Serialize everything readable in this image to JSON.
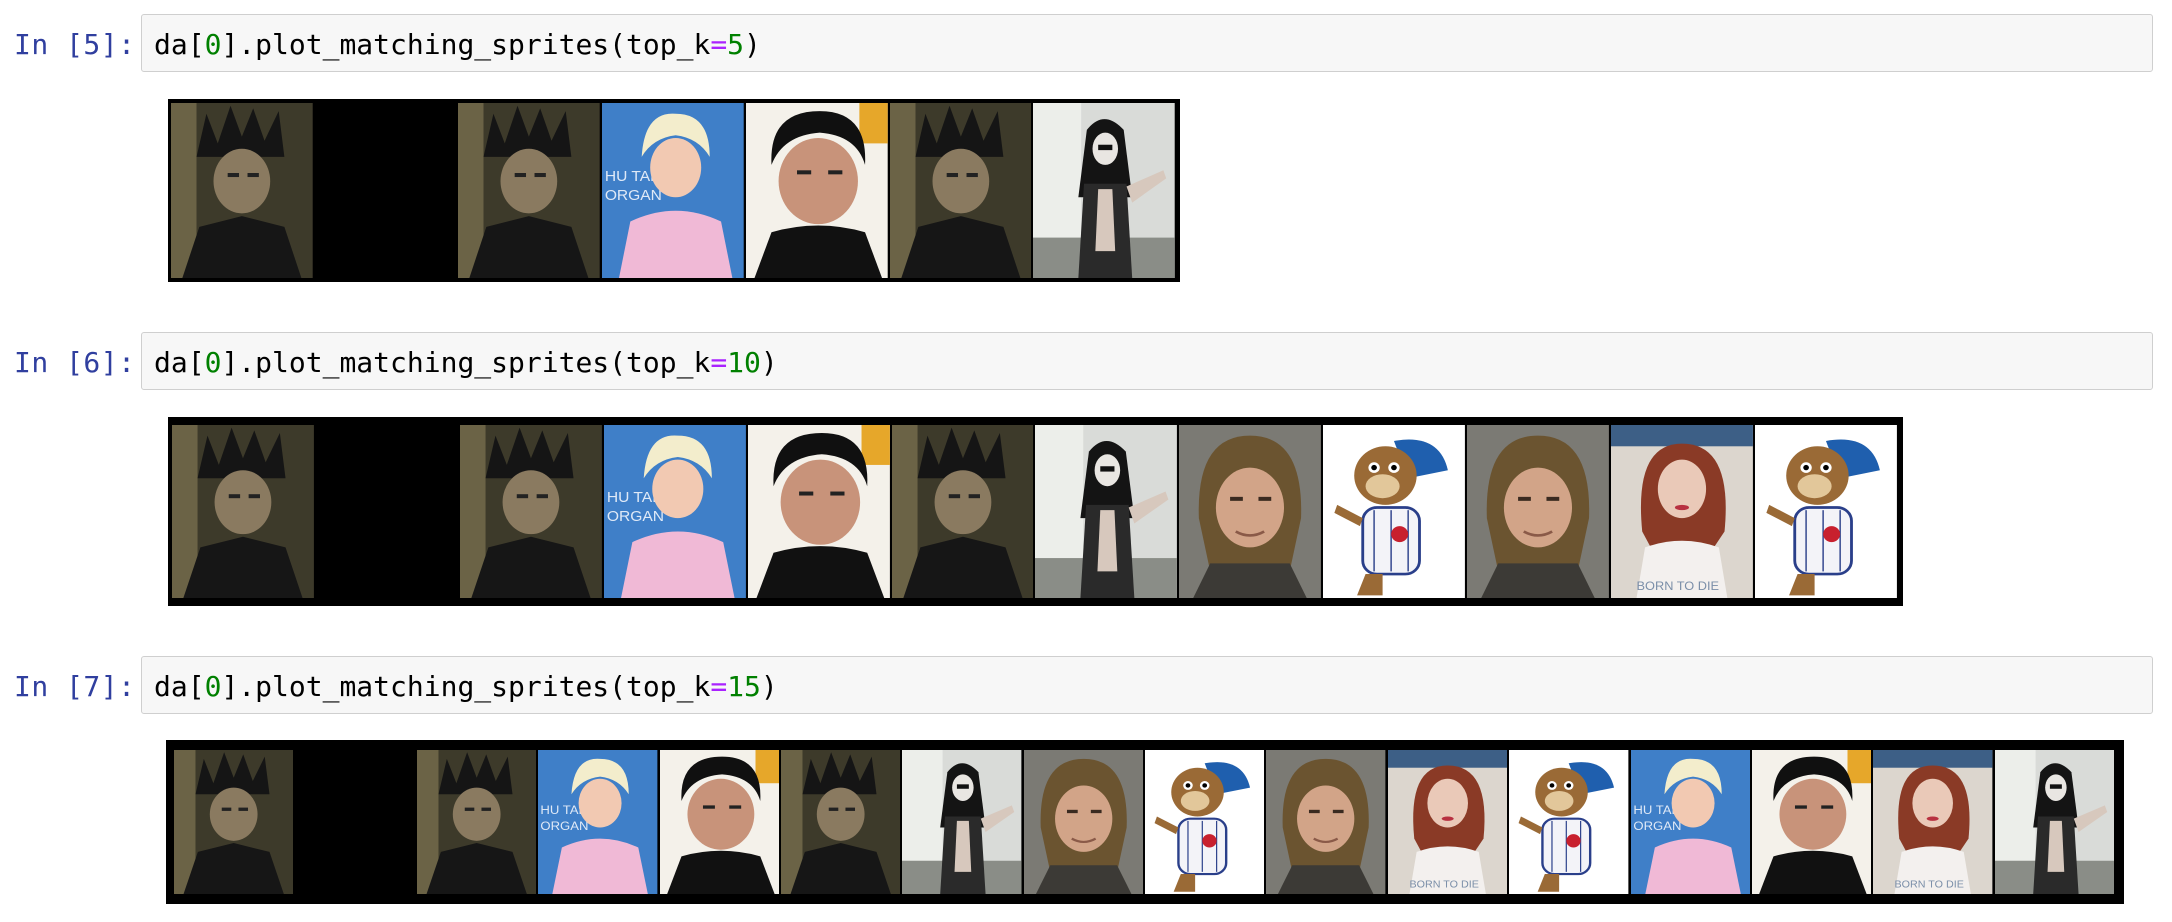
{
  "cells": [
    {
      "prompt": "In [5]:",
      "code": {
        "pre": "da[",
        "idx": "0",
        "mid": "].plot_matching_sprites(top_k",
        "op": "=",
        "arg": "5",
        "post": ")"
      },
      "sprites": [
        "person-spiky-hair",
        "blank",
        "person-spiky-hair",
        "blonde-woman",
        "dark-haired-man",
        "person-spiky-hair",
        "person-long-black-hair"
      ]
    },
    {
      "prompt": "In [6]:",
      "code": {
        "pre": "da[",
        "idx": "0",
        "mid": "].plot_matching_sprites(top_k",
        "op": "=",
        "arg": "10",
        "post": ")"
      },
      "sprites": [
        "person-spiky-hair",
        "blank",
        "person-spiky-hair",
        "blonde-woman",
        "dark-haired-man",
        "person-spiky-hair",
        "person-long-black-hair",
        "long-haired-man",
        "cartoon-bear",
        "long-haired-man",
        "red-haired-woman",
        "cartoon-bear"
      ]
    },
    {
      "prompt": "In [7]:",
      "code": {
        "pre": "da[",
        "idx": "0",
        "mid": "].plot_matching_sprites(top_k",
        "op": "=",
        "arg": "15",
        "post": ")"
      },
      "sprites": [
        "person-spiky-hair",
        "blank",
        "person-spiky-hair",
        "blonde-woman",
        "dark-haired-man",
        "person-spiky-hair",
        "person-long-black-hair",
        "long-haired-man",
        "cartoon-bear",
        "long-haired-man",
        "red-haired-woman",
        "cartoon-bear",
        "blonde-woman",
        "dark-haired-man",
        "red-haired-woman",
        "person-long-black-hair"
      ]
    }
  ],
  "colors": {
    "prompt": "#303f9f",
    "number": "#008000",
    "operator": "#aa22ff",
    "input_bg": "#f7f7f7",
    "input_border": "#cfcfcf"
  }
}
